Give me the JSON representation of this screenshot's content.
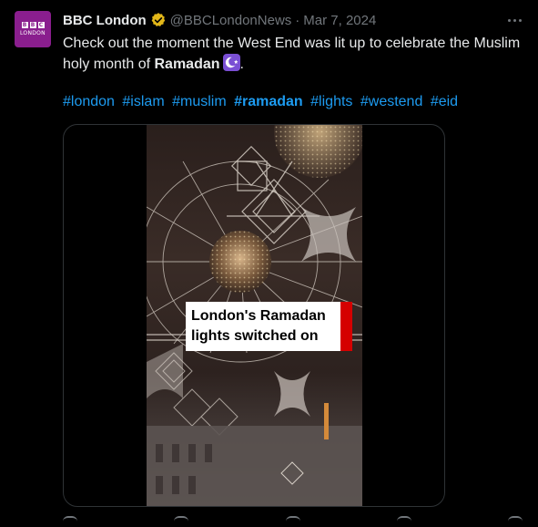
{
  "avatar": {
    "logo_letters": [
      "B",
      "B",
      "C"
    ],
    "subtitle": "LONDON"
  },
  "header": {
    "name": "BBC London",
    "handle": "@BBCLondonNews",
    "separator": "·",
    "date": "Mar 7, 2024"
  },
  "tweet": {
    "text_before": "Check out the moment the West End was lit up to celebrate the Muslim holy month of ",
    "text_bold": "Ramadan",
    "text_after": ".",
    "emoji": "crescent-star-emoji"
  },
  "hashtags": [
    "#london",
    "#islam",
    "#muslim",
    "#ramadan",
    "#lights",
    "#westend",
    "#eid"
  ],
  "media": {
    "caption_line1": "London's Ramadan",
    "caption_line2": "lights switched on"
  },
  "colors": {
    "accent": "#1d9bf0",
    "verified": "#e2b719",
    "avatar_bg": "#8a1e8e",
    "caption_bar": "#d50000"
  }
}
